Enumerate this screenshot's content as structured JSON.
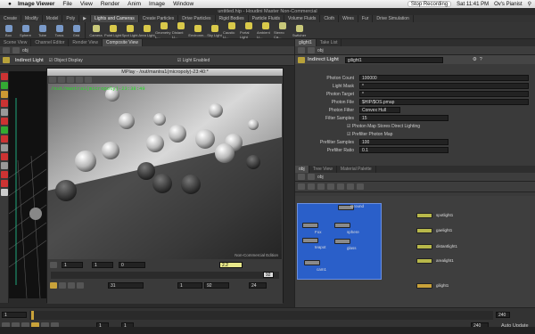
{
  "menubar": {
    "apple": "",
    "app": "Image Viewer",
    "items": [
      "File",
      "View",
      "Render",
      "Anim",
      "Image",
      "Window"
    ],
    "recording": "Stop Recording",
    "time": "Sat 11:41 PM",
    "user": "Ov's Pianist"
  },
  "window_title": "untitled.hip - Houdini Master Non-Commercial",
  "shelf_tabs": [
    "Create",
    "Modify",
    "Model",
    "Poly",
    "",
    "Lights and Cameras",
    "Create Particles",
    "Drive Particles",
    "Rigid Bodies",
    "Particle Fluids",
    "Volume Fluids",
    "Cloth",
    "Wires",
    "Fur",
    "Drive Simulation"
  ],
  "shelf_tools": [
    {
      "label": "Box",
      "color": "#7a9ac9"
    },
    {
      "label": "Sphere",
      "color": "#7a9ac9"
    },
    {
      "label": "Tube",
      "color": "#7a9ac9"
    },
    {
      "label": "Torus",
      "color": "#7a9ac9"
    },
    {
      "label": "Grid",
      "color": "#7a9ac9"
    },
    {
      "label": "Camera",
      "color": "#c9c97a"
    },
    {
      "label": "Point Light",
      "color": "#d9c94a"
    },
    {
      "label": "Spot Light",
      "color": "#d9c94a"
    },
    {
      "label": "Area Light",
      "color": "#d9c94a"
    },
    {
      "label": "Geometry L...",
      "color": "#d9c94a"
    },
    {
      "label": "Distant Li...",
      "color": "#d9c94a"
    },
    {
      "label": "Environm...",
      "color": "#d9c94a"
    },
    {
      "label": "Sky Light",
      "color": "#d9c94a"
    },
    {
      "label": "Caustic Li...",
      "color": "#d9c94a"
    },
    {
      "label": "Portal Light",
      "color": "#d9c94a"
    },
    {
      "label": "Ambient Li...",
      "color": "#d9c94a"
    },
    {
      "label": "Stereo Ca...",
      "color": "#c9c97a"
    },
    {
      "label": "Switcher",
      "color": "#c9c97a"
    }
  ],
  "left_tabs": [
    "Scene View",
    "Channel Editor",
    "Render View",
    "Composite View"
  ],
  "left_path": "obj",
  "viewer_header": {
    "node": "Indirect Light",
    "object_display": "Object Display",
    "light_enabled": "Light Enabled"
  },
  "mplay": {
    "title": "MPlay - /out/mantra1(micropoly)-23:40:*",
    "tag": "/out/mantra1(micropoly)-23:38:49",
    "watermark": "Non-Commercial Edition",
    "zoom": "2.2",
    "frame": "31",
    "start": "1",
    "end": "240",
    "step": "1",
    "val1": "1",
    "val2": "0",
    "val3": "1",
    "fps": "24",
    "frame_end": "92"
  },
  "timeline": {
    "frame": "1",
    "start": "1",
    "end": "240",
    "rend": "240",
    "auto": "Auto Update"
  },
  "params": {
    "tabs": [
      "glight1",
      "Take List"
    ],
    "path": "obj",
    "node_type": "Indirect Light",
    "node_name": "gilight1",
    "rows": [
      {
        "label": "Photon Count",
        "value": "100000"
      },
      {
        "label": "Light Mask",
        "value": "*"
      },
      {
        "label": "Photon Target",
        "value": "*"
      },
      {
        "label": "Photon File",
        "value": "$HIP/$OS.pmap"
      },
      {
        "label": "Photon Filter",
        "value": "Convex Hull"
      },
      {
        "label": "Filter Samples",
        "value": "15"
      },
      {
        "label": "",
        "value": "Photon Map Stores Direct Lighting"
      },
      {
        "label": "",
        "value": "Prefilter Photon Map"
      },
      {
        "label": "Prefilter Samples",
        "value": "100"
      },
      {
        "label": "Prefilter Ratio",
        "value": "0.1"
      }
    ]
  },
  "network": {
    "tabs": [
      "obj",
      "Tree View",
      "Material Palette"
    ],
    "path": "obj",
    "nodes": [
      "Ground",
      "Fox",
      "sphere",
      "teapot",
      "glass",
      "cam1",
      "spotlight1",
      "gaelight1",
      "distantlight1",
      "arealight1",
      "gilight1"
    ]
  }
}
